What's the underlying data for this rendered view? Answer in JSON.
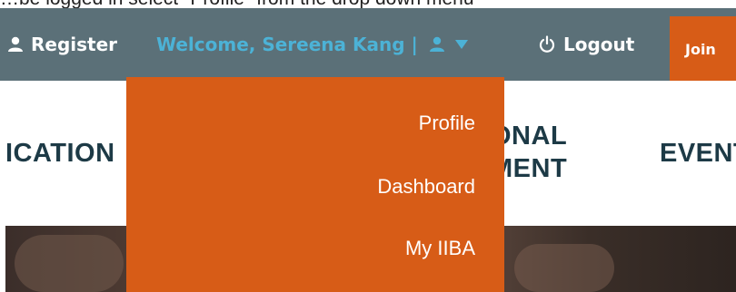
{
  "caption": "…be logged in select \"Profile\" from the drop down menu",
  "topbar": {
    "register_label": "Register",
    "welcome_label": "Welcome, Sereena Kang |",
    "logout_label": "Logout",
    "join_label": "Join"
  },
  "nav": {
    "items": [
      "ICATION",
      "ONAL",
      "MENT",
      "EVENT"
    ]
  },
  "dropdown": {
    "items": [
      "Profile",
      "Dashboard",
      "My IIBA"
    ]
  },
  "colors": {
    "topbar": "#5b7078",
    "accent_orange": "#d75c17",
    "welcome_blue": "#4cb2d6",
    "nav_text": "#1d3a46"
  },
  "icons": {
    "register": "user-icon",
    "account": "user-icon",
    "caret": "caret-down-icon",
    "logout": "power-icon"
  }
}
